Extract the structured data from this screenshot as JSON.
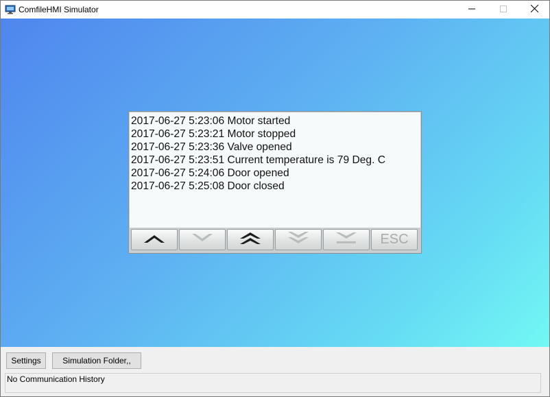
{
  "window": {
    "title": "ComfileHMI Simulator",
    "controls": {
      "minimize_icon": "minimize-icon",
      "maximize_icon": "maximize-icon",
      "close_icon": "close-icon"
    }
  },
  "log": {
    "entries": [
      "2017-06-27 5:23:06 Motor started",
      "2017-06-27 5:23:21 Motor stopped",
      "2017-06-27 5:23:36 Valve opened",
      "2017-06-27 5:23:51 Current temperature is 79 Deg. C",
      "2017-06-27 5:24:06 Door opened",
      "2017-06-27 5:25:08 Door closed"
    ],
    "nav_buttons": [
      {
        "icon": "chevron-up-icon",
        "enabled": true
      },
      {
        "icon": "chevron-down-icon",
        "enabled": false
      },
      {
        "icon": "double-chevron-up-icon",
        "enabled": true
      },
      {
        "icon": "double-chevron-down-icon",
        "enabled": false
      },
      {
        "icon": "scroll-to-bottom-icon",
        "enabled": false
      },
      {
        "label": "ESC",
        "enabled": false
      }
    ]
  },
  "toolbar": {
    "settings_label": "Settings",
    "simulation_folder_label": "Simulation Folder,,"
  },
  "status": {
    "text": "No Communication History"
  },
  "colors": {
    "background_gradient_start": "#4f86ee",
    "background_gradient_end": "#72f8f4",
    "nav_icon_enabled": "#1c1c1c",
    "nav_icon_disabled": "#b8bcbc"
  }
}
